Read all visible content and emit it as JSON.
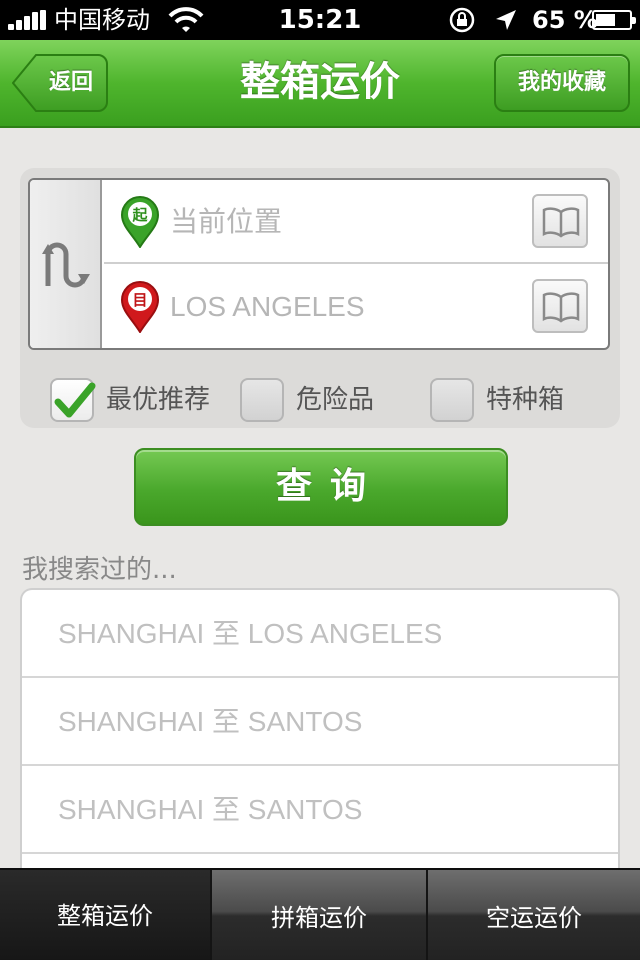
{
  "status_bar": {
    "carrier": "中国移动",
    "time": "15:21",
    "battery_percent": "65 %",
    "battery_level": 0.65,
    "icons": [
      "signal-icon",
      "wifi-icon",
      "rotation-lock-icon",
      "location-arrow-icon",
      "battery-icon"
    ]
  },
  "nav": {
    "title": "整箱运价",
    "back_label": "返回",
    "favorites_label": "我的收藏"
  },
  "search": {
    "from_badge": "起",
    "from_value": "当前位置",
    "to_badge": "目",
    "to_value": "LOS ANGELES",
    "options": [
      {
        "label": "最优推荐",
        "checked": true
      },
      {
        "label": "危险品",
        "checked": false
      },
      {
        "label": "特种箱",
        "checked": false
      }
    ],
    "query_label": "查询"
  },
  "history": {
    "title": "我搜索过的...",
    "items": [
      "SHANGHAI 至 LOS ANGELES",
      "SHANGHAI 至 SANTOS",
      "SHANGHAI 至 SANTOS"
    ]
  },
  "tabs": [
    {
      "label": "整箱运价",
      "active": true
    },
    {
      "label": "拼箱运价",
      "active": false
    },
    {
      "label": "空运运价",
      "active": false
    }
  ],
  "colors": {
    "nav_green": "#4fb52d",
    "pin_green": "#3aa329",
    "pin_red": "#d0191c",
    "check_green": "#3aa329"
  }
}
